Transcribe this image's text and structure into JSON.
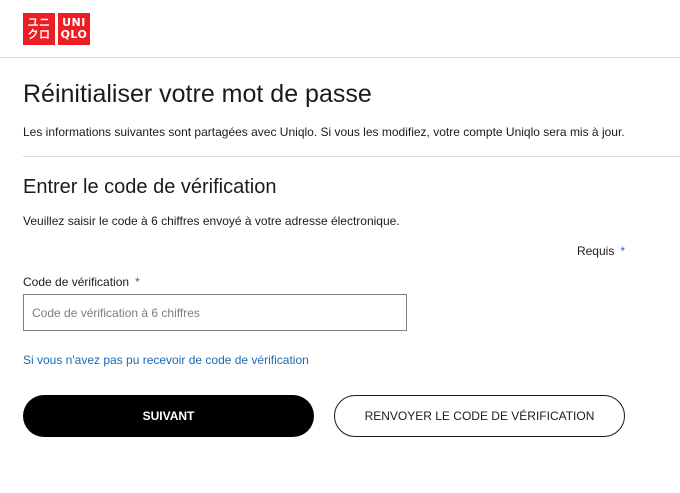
{
  "brand": {
    "logo_left_line1": "ユニ",
    "logo_left_line2": "クロ",
    "logo_right_line1": "UNI",
    "logo_right_line2": "QLO",
    "color": "#ed1d24"
  },
  "page": {
    "title": "Réinitialiser votre mot de passe",
    "info": "Les informations suivantes sont partagées avec Uniqlo. Si vous les modifiez, votre compte Uniqlo sera mis à jour."
  },
  "section": {
    "title": "Entrer le code de vérification",
    "instruction": "Veuillez saisir le code à 6 chiffres envoyé à votre adresse électronique.",
    "required_label": "Requis",
    "required_mark": "*"
  },
  "form": {
    "code_label": "Code de vérification",
    "code_required_mark": "*",
    "code_placeholder": "Code de vérification à 6 chiffres",
    "code_value": ""
  },
  "links": {
    "no_code": "Si vous n'avez pas pu recevoir de code de vérification"
  },
  "buttons": {
    "next": "SUIVANT",
    "resend": "RENVOYER LE CODE DE VÉRIFICATION"
  }
}
